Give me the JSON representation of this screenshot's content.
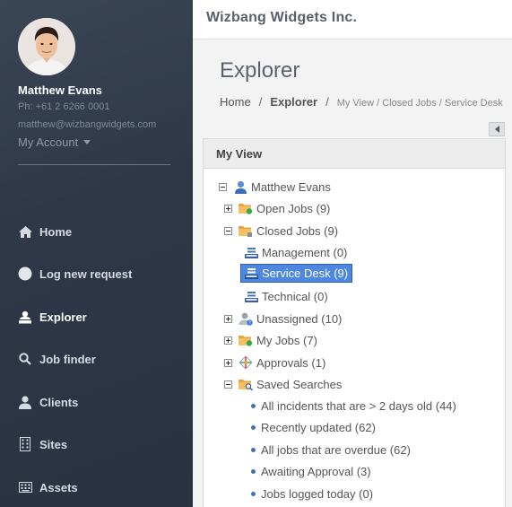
{
  "user": {
    "name": "Matthew Evans",
    "phone": "Ph: +61 2 6266 0001",
    "email": "matthew@wizbangwidgets.com",
    "account_label": "My Account"
  },
  "nav": [
    {
      "label": "Home",
      "icon": "home-icon"
    },
    {
      "label": "Log new request",
      "icon": "circle-icon"
    },
    {
      "label": "Explorer",
      "icon": "explorer-icon"
    },
    {
      "label": "Job finder",
      "icon": "search-icon"
    },
    {
      "label": "Clients",
      "icon": "user-icon"
    },
    {
      "label": "Sites",
      "icon": "building-icon"
    },
    {
      "label": "Assets",
      "icon": "keyboard-icon"
    }
  ],
  "header": {
    "company": "Wizbang Widgets Inc.",
    "page_title": "Explorer"
  },
  "breadcrumb": {
    "home": "Home",
    "current": "Explorer",
    "path": "My View / Closed Jobs / Service Desk"
  },
  "panel": {
    "title": "My View",
    "tree": [
      {
        "label": "Matthew Evans"
      },
      {
        "label": "Open Jobs (9)"
      },
      {
        "label": "Closed Jobs (9)"
      },
      {
        "label": "Management (0)"
      },
      {
        "label": "Service Desk (9)"
      },
      {
        "label": "Technical (0)"
      },
      {
        "label": "Unassigned (10)"
      },
      {
        "label": "My Jobs (7)"
      },
      {
        "label": "Approvals (1)"
      },
      {
        "label": "Saved Searches"
      },
      {
        "label": "All incidents that are > 2 days old (44)"
      },
      {
        "label": "Recently updated (62)"
      },
      {
        "label": "All jobs that are overdue (62)"
      },
      {
        "label": "Awaiting Approval (3)"
      },
      {
        "label": "Jobs logged today (0)"
      }
    ]
  },
  "colors": {
    "sidebar": "#2e3848",
    "selection": "#4e86e0",
    "bullet": "#3d73b8"
  }
}
